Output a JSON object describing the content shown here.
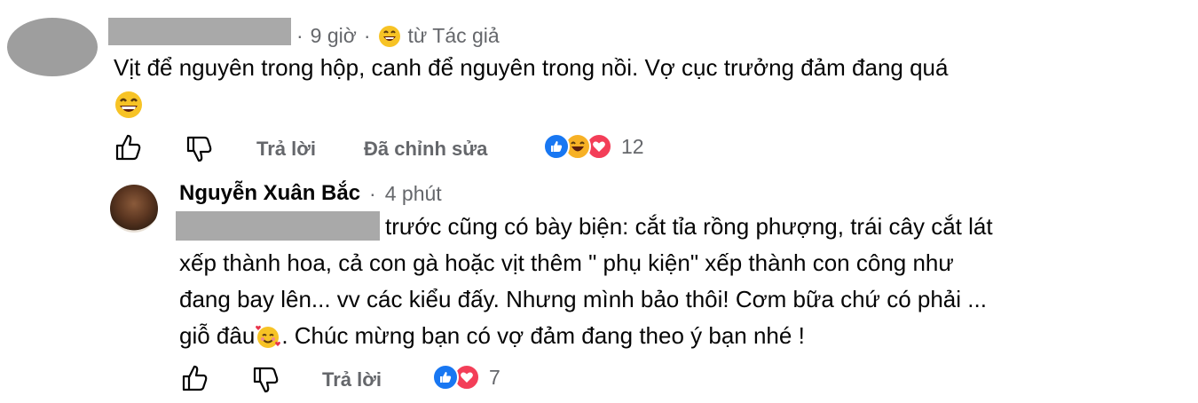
{
  "comment": {
    "time": "9 giờ",
    "separator": "·",
    "source_label": "từ Tác giả",
    "text": "Vịt để nguyên trong hộp, canh để nguyên trong nồi. Vợ cục trưởng đảm đang quá",
    "actions": {
      "reply": "Trả lời",
      "edited": "Đã chỉnh sửa"
    },
    "reaction_count": "12",
    "reactions": [
      "like-icon",
      "haha-icon",
      "love-icon"
    ]
  },
  "reply": {
    "author": "Nguyễn Xuân Bắc",
    "separator": "·",
    "time": "4 phút",
    "line1": "trước cũng có bày biện: cắt tỉa rồng phượng, trái cây cắt lát",
    "line2": "xếp thành hoa, cả con gà hoặc vịt thêm \" phụ kiện\" xếp thành con công như",
    "line3": "đang bay lên... vv các kiểu đấy. Nhưng mình bảo thôi! Cơm bữa chứ có phải ...",
    "line4_a": "giỗ đâu",
    "line4_b": ". Chúc mừng bạn có vợ đảm đang theo ý bạn nhé !",
    "actions": {
      "reply": "Trả lời"
    },
    "reaction_count": "7",
    "reactions": [
      "like-icon",
      "love-icon"
    ]
  },
  "colors": {
    "like": "#1877f2",
    "love": "#f33e58",
    "haha": "#f7b125",
    "secondary_text": "#65676b"
  }
}
